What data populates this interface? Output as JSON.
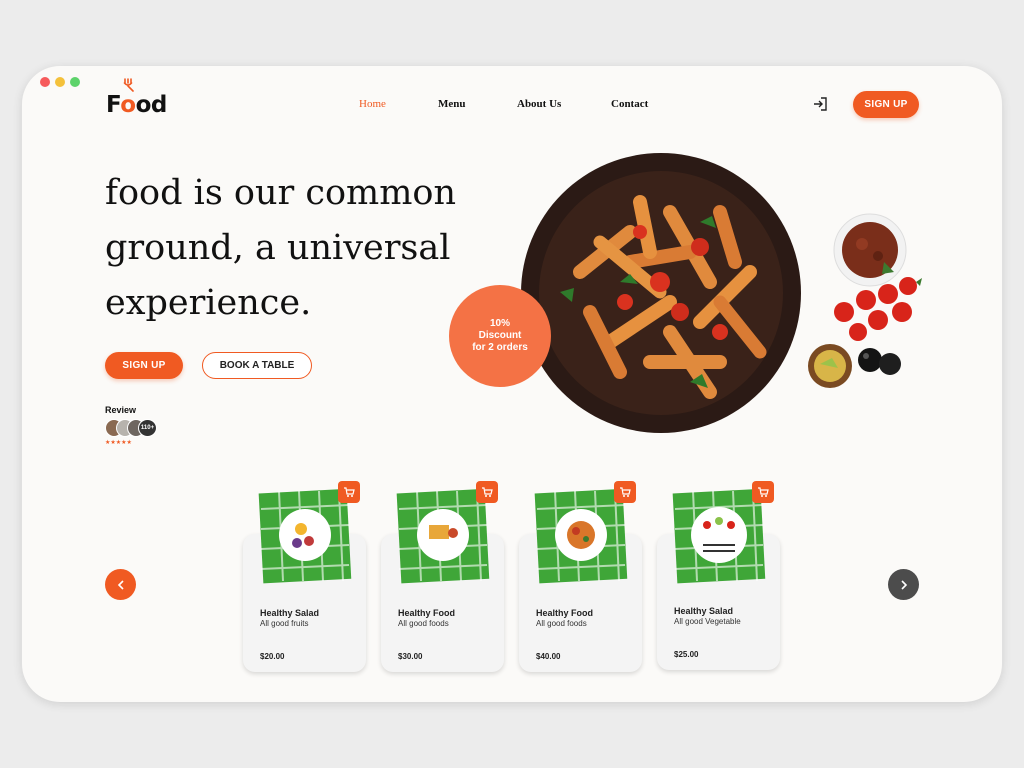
{
  "window_controls": {
    "colors": [
      "#f65a5b",
      "#f4c13b",
      "#5dd36b"
    ]
  },
  "brand": {
    "logo_f": "F",
    "logo_o1": "o",
    "logo_rest": "od",
    "accent": "#f05a22"
  },
  "nav": {
    "items": [
      {
        "label": "Home",
        "active": true
      },
      {
        "label": "Menu",
        "active": false
      },
      {
        "label": "About Us",
        "active": false
      },
      {
        "label": "Contact",
        "active": false
      }
    ],
    "signup": "SIGN UP"
  },
  "hero": {
    "title": "food is our common ground, a universal experience.",
    "signup": "SIGN UP",
    "book": "BOOK A TABLE",
    "review_label": "Review",
    "review_count": "110+",
    "stars": "★★★★★"
  },
  "discount": {
    "line1": "10%",
    "line2": "Discount",
    "line3": "for 2 orders"
  },
  "cards": [
    {
      "title": "Healthy Salad",
      "subtitle": "All good fruits",
      "price": "$20.00"
    },
    {
      "title": "Healthy Food",
      "subtitle": "All good foods",
      "price": "$30.00"
    },
    {
      "title": "Healthy Food",
      "subtitle": "All good foods",
      "price": "$40.00"
    },
    {
      "title": "Healthy Salad",
      "subtitle": "All good Vegetable",
      "price": "$25.00"
    }
  ],
  "icons": {
    "login": "login-icon",
    "cart": "cart-icon",
    "prev": "chevron-left-icon",
    "next": "chevron-right-icon"
  }
}
